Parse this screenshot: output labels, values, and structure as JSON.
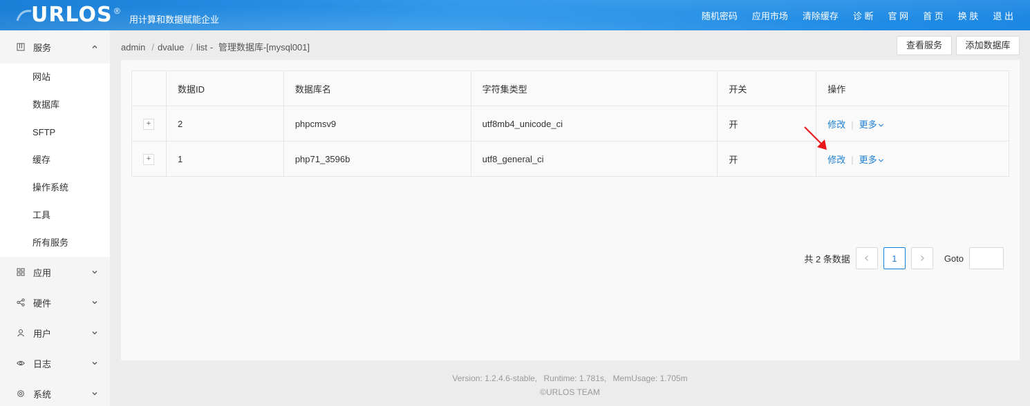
{
  "header": {
    "logo": "URLOS",
    "logo_reg": "®",
    "slogan": "用计算和数据赋能企业",
    "nav": [
      "随机密码",
      "应用市场",
      "清除缓存",
      "诊 断",
      "官 网",
      "首 页",
      "换 肤",
      "退 出"
    ]
  },
  "sidebar": {
    "service_group": {
      "label": "服务",
      "icon": "grid-box-icon",
      "items": [
        "网站",
        "数据库",
        "SFTP",
        "缓存",
        "操作系统",
        "工具",
        "所有服务"
      ]
    },
    "groups": [
      {
        "label": "应用",
        "icon": "apps-grid-icon"
      },
      {
        "label": "硬件",
        "icon": "share-nodes-icon"
      },
      {
        "label": "用户",
        "icon": "user-icon"
      },
      {
        "label": "日志",
        "icon": "eye-icon"
      },
      {
        "label": "系统",
        "icon": "gear-icon"
      }
    ]
  },
  "breadcrumb": {
    "parts": [
      "admin",
      "dvalue",
      "list"
    ],
    "separators": [
      "/",
      "/"
    ],
    "dash": "-",
    "page_title": "管理数据库-[mysql001]"
  },
  "actions": {
    "view_service": "查看服务",
    "add_database": "添加数据库"
  },
  "table": {
    "columns": [
      "",
      "数据ID",
      "数据库名",
      "字符集类型",
      "开关",
      "操作"
    ],
    "rows": [
      {
        "expand": "+",
        "id": "2",
        "name": "phpcmsv9",
        "charset": "utf8mb4_unicode_ci",
        "switch": "开",
        "edit": "修改",
        "sep": "|",
        "more": "更多"
      },
      {
        "expand": "+",
        "id": "1",
        "name": "php71_3596b",
        "charset": "utf8_general_ci",
        "switch": "开",
        "edit": "修改",
        "sep": "|",
        "more": "更多"
      }
    ]
  },
  "pagination": {
    "total": "共 2 条数据",
    "current": "1",
    "goto_label": "Goto",
    "goto_value": ""
  },
  "footer": {
    "version": "Version: 1.2.4.6-stable,",
    "runtime": "Runtime: 1.781s,",
    "mem": "MemUsage: 1.705m",
    "copyright": "©URLOS TEAM"
  },
  "colors": {
    "header_blue": "#1a7fd6",
    "link_blue": "#1a7fd6",
    "annotation_arrow": "#e8161b"
  }
}
